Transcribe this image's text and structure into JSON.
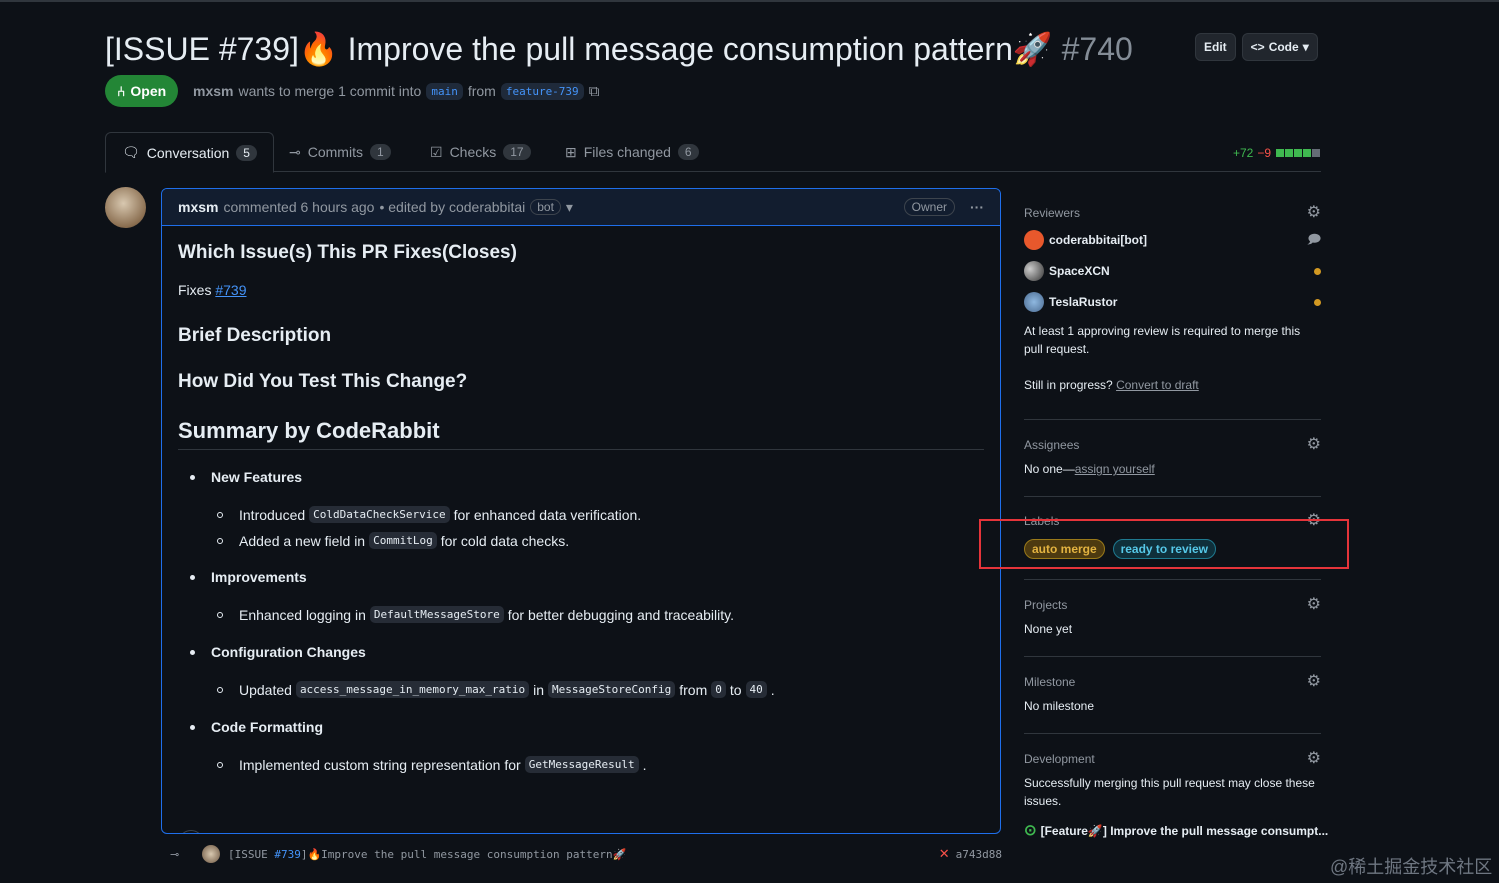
{
  "pr": {
    "title": "[ISSUE #739]🔥 Improve the pull message consumption pattern🚀",
    "number": "#740",
    "state": "Open",
    "author": "mxsm",
    "merge_text": "wants to merge 1 commit into",
    "base": "main",
    "from": "from",
    "head": "feature-739",
    "edit": "Edit",
    "code": "Code"
  },
  "tabs": [
    {
      "label": "Conversation",
      "count": "5"
    },
    {
      "label": "Commits",
      "count": "1"
    },
    {
      "label": "Checks",
      "count": "17"
    },
    {
      "label": "Files changed",
      "count": "6"
    }
  ],
  "diffstat": {
    "add": "+72",
    "del": "−9"
  },
  "comment": {
    "author": "mxsm",
    "action": "commented 6 hours ago",
    "edited": "• edited by coderabbitai",
    "bot": "bot",
    "owner": "Owner",
    "h_fixes": "Which Issue(s) This PR Fixes(Closes)",
    "fixes_label": "Fixes",
    "fixes_link": "#739",
    "h_brief": "Brief Description",
    "h_test": "How Did You Test This Change?",
    "h_summary": "Summary by CodeRabbit",
    "s1": "New Features",
    "s1a_pre": "Introduced",
    "s1a_code": "ColdDataCheckService",
    "s1a_post": "for enhanced data verification.",
    "s1b_pre": "Added a new field in",
    "s1b_code": "CommitLog",
    "s1b_post": "for cold data checks.",
    "s2": "Improvements",
    "s2a_pre": "Enhanced logging in",
    "s2a_code": "DefaultMessageStore",
    "s2a_post": "for better debugging and traceability.",
    "s3": "Configuration Changes",
    "s3a_pre": "Updated",
    "s3a_code1": "access_message_in_memory_max_ratio",
    "s3a_in": "in",
    "s3a_code2": "MessageStoreConfig",
    "s3a_from": "from",
    "s3a_v1": "0",
    "s3a_to": "to",
    "s3a_v2": "40",
    "s3a_end": ".",
    "s4": "Code Formatting",
    "s4a_pre": "Implemented custom string representation for",
    "s4a_code": "GetMessageResult",
    "s4a_end": "."
  },
  "commit": {
    "pre": "[ISSUE ",
    "link": "#739",
    "post": "]🔥Improve the pull message consumption pattern🚀",
    "sha": "a743d88"
  },
  "sidebar": {
    "reviewers": "Reviewers",
    "rev": [
      "coderabbitai[bot]",
      "SpaceXCN",
      "TeslaRustor"
    ],
    "approve_note": "At least 1 approving review is required to merge this pull request.",
    "progress": "Still in progress?",
    "convert": "Convert to draft",
    "assignees": "Assignees",
    "no_one": "No one—",
    "assign": "assign yourself",
    "labels": "Labels",
    "label1": "auto merge",
    "label2": "ready to review",
    "projects": "Projects",
    "none_yet": "None yet",
    "milestone": "Milestone",
    "no_milestone": "No milestone",
    "development": "Development",
    "dev_note": "Successfully merging this pull request may close these issues.",
    "dev_issue": "[Feature🚀] Improve the pull message consumpt..."
  },
  "colors": {
    "accent": "#1f6feb",
    "open": "#238636",
    "label_auto": "#d29922",
    "label_ready": "#1fb8cd",
    "highlight_box": "#e5343a"
  },
  "watermark": "@稀土掘金技术社区"
}
